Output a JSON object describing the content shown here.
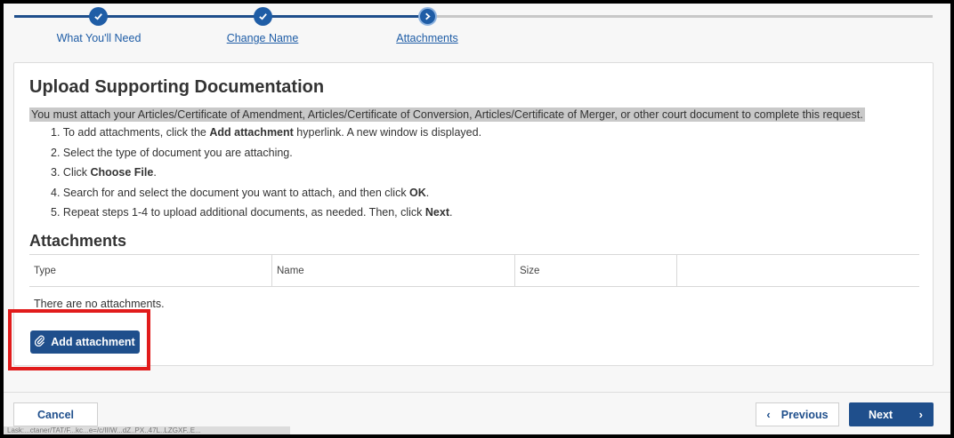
{
  "stepper": {
    "steps": [
      {
        "label": "What You'll Need",
        "icon": "check-icon",
        "state": "complete"
      },
      {
        "label": "Change Name",
        "icon": "check-icon",
        "state": "complete"
      },
      {
        "label": "Attachments",
        "icon": "chevron-right-icon",
        "state": "current"
      }
    ]
  },
  "page": {
    "title": "Upload Supporting Documentation",
    "notice": "You must attach your Articles/Certificate of Amendment, Articles/Certificate of Conversion, Articles/Certificate of Merger, or other court document to complete this request.",
    "instructions": [
      {
        "num": "1.",
        "pre": "To add attachments, click the ",
        "bold": "Add attachment",
        "post": " hyperlink. A new window is displayed."
      },
      {
        "num": "2.",
        "pre": "Select the type of document you are attaching.",
        "bold": "",
        "post": ""
      },
      {
        "num": "3.",
        "pre": "Click ",
        "bold": "Choose File",
        "post": "."
      },
      {
        "num": "4.",
        "pre": "Search for and select the document you want to attach, and then click ",
        "bold": "OK",
        "post": "."
      },
      {
        "num": "5.",
        "pre": "Repeat steps 1-4 to upload additional documents, as needed. Then, click ",
        "bold": "Next",
        "post": "."
      }
    ]
  },
  "attachments": {
    "heading": "Attachments",
    "columns": [
      "Type",
      "Name",
      "Size",
      ""
    ],
    "empty_text": "There are no attachments.",
    "add_label": "Add attachment",
    "add_icon": "paperclip-icon"
  },
  "footer": {
    "cancel_label": "Cancel",
    "previous_label": "Previous",
    "next_label": "Next",
    "status_url": "Lask:...ctaner/TAT/F...kc...e=/c/IIIW...dZ..PX..47L..LZGXF..E..."
  },
  "colors": {
    "primary": "#1f4f8c",
    "step_active": "#1f5da6",
    "highlight": "#e11b1b"
  }
}
